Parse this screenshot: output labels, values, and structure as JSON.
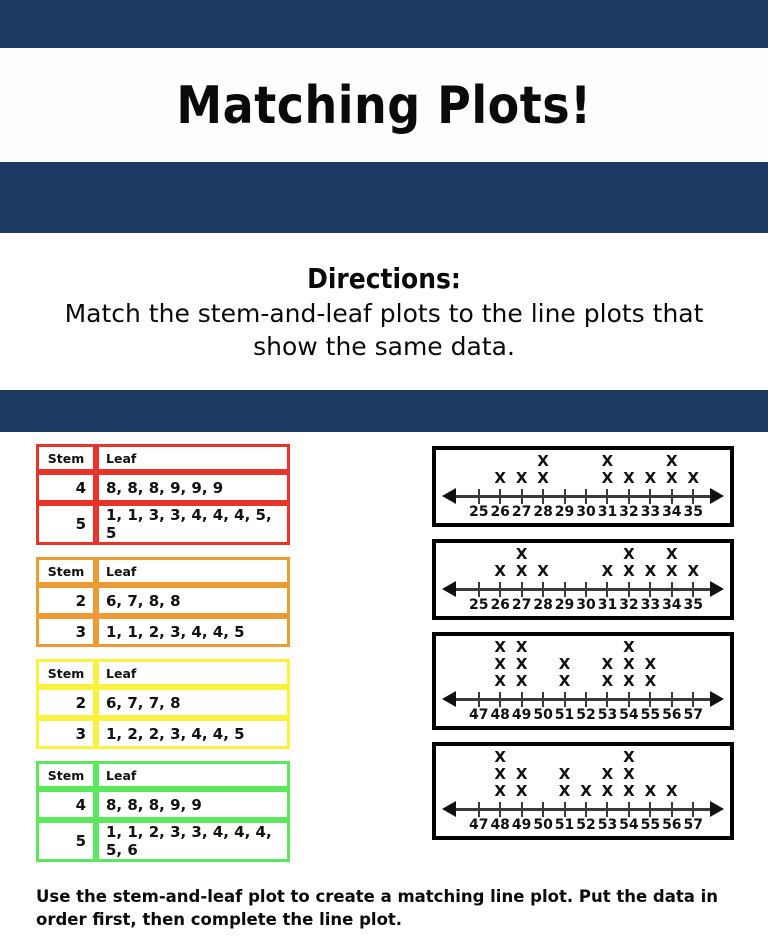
{
  "header": {
    "title": "Matching Plots!",
    "navy_color": "#1d3a62"
  },
  "directions": {
    "heading": "Directions:",
    "text": "Match the stem-and-leaf plots to the line plots that show the same data."
  },
  "stem_leaf_plots": [
    {
      "color_name": "red",
      "color": "#e8352a",
      "header": {
        "stem": "Stem",
        "leaf": "Leaf"
      },
      "rows": [
        {
          "stem": "4",
          "leaf": "8, 8, 8, 9, 9, 9"
        },
        {
          "stem": "5",
          "leaf": "1, 1, 3, 3, 4, 4, 4, 5, 5"
        }
      ]
    },
    {
      "color_name": "orange",
      "color": "#ed9b33",
      "header": {
        "stem": "Stem",
        "leaf": "Leaf"
      },
      "rows": [
        {
          "stem": "2",
          "leaf": "6, 7, 8, 8"
        },
        {
          "stem": "3",
          "leaf": "1, 1, 2, 3, 4, 4, 5"
        }
      ]
    },
    {
      "color_name": "yellow",
      "color": "#fbf13f",
      "header": {
        "stem": "Stem",
        "leaf": "Leaf"
      },
      "rows": [
        {
          "stem": "2",
          "leaf": "6, 7, 7, 8"
        },
        {
          "stem": "3",
          "leaf": "1, 2, 2, 3, 4, 4, 5"
        }
      ]
    },
    {
      "color_name": "green",
      "color": "#5ce85c",
      "header": {
        "stem": "Stem",
        "leaf": "Leaf"
      },
      "rows": [
        {
          "stem": "4",
          "leaf": "8, 8, 8, 9, 9"
        },
        {
          "stem": "5",
          "leaf": "1, 1, 2, 3, 3, 4, 4, 4, 5, 6"
        }
      ]
    }
  ],
  "footer": {
    "note": "Use the stem-and-leaf plot to create a matching line plot.  Put the data in order first, then complete the line plot."
  },
  "chart_data": [
    {
      "type": "line-plot",
      "title": "",
      "xlabel": "",
      "ylabel": "",
      "marker": "X",
      "categories": [
        25,
        26,
        27,
        28,
        29,
        30,
        31,
        32,
        33,
        34,
        35
      ],
      "values": [
        0,
        1,
        1,
        2,
        0,
        0,
        2,
        1,
        1,
        2,
        1
      ],
      "ylim": [
        0,
        2
      ],
      "grid": false,
      "legend": "none"
    },
    {
      "type": "line-plot",
      "title": "",
      "xlabel": "",
      "ylabel": "",
      "marker": "X",
      "categories": [
        25,
        26,
        27,
        28,
        29,
        30,
        31,
        32,
        33,
        34,
        35
      ],
      "values": [
        0,
        1,
        2,
        1,
        0,
        0,
        1,
        2,
        1,
        2,
        1
      ],
      "ylim": [
        0,
        2
      ],
      "grid": false,
      "legend": "none"
    },
    {
      "type": "line-plot",
      "title": "",
      "xlabel": "",
      "ylabel": "",
      "marker": "X",
      "categories": [
        47,
        48,
        49,
        50,
        51,
        52,
        53,
        54,
        55,
        56,
        57
      ],
      "values": [
        0,
        3,
        3,
        0,
        2,
        0,
        2,
        3,
        2,
        0,
        0
      ],
      "ylim": [
        0,
        3
      ],
      "grid": false,
      "legend": "none"
    },
    {
      "type": "line-plot",
      "title": "",
      "xlabel": "",
      "ylabel": "",
      "marker": "X",
      "categories": [
        47,
        48,
        49,
        50,
        51,
        52,
        53,
        54,
        55,
        56,
        57
      ],
      "values": [
        0,
        3,
        2,
        0,
        2,
        1,
        2,
        3,
        1,
        1,
        0
      ],
      "ylim": [
        0,
        3
      ],
      "grid": false,
      "legend": "none"
    }
  ]
}
